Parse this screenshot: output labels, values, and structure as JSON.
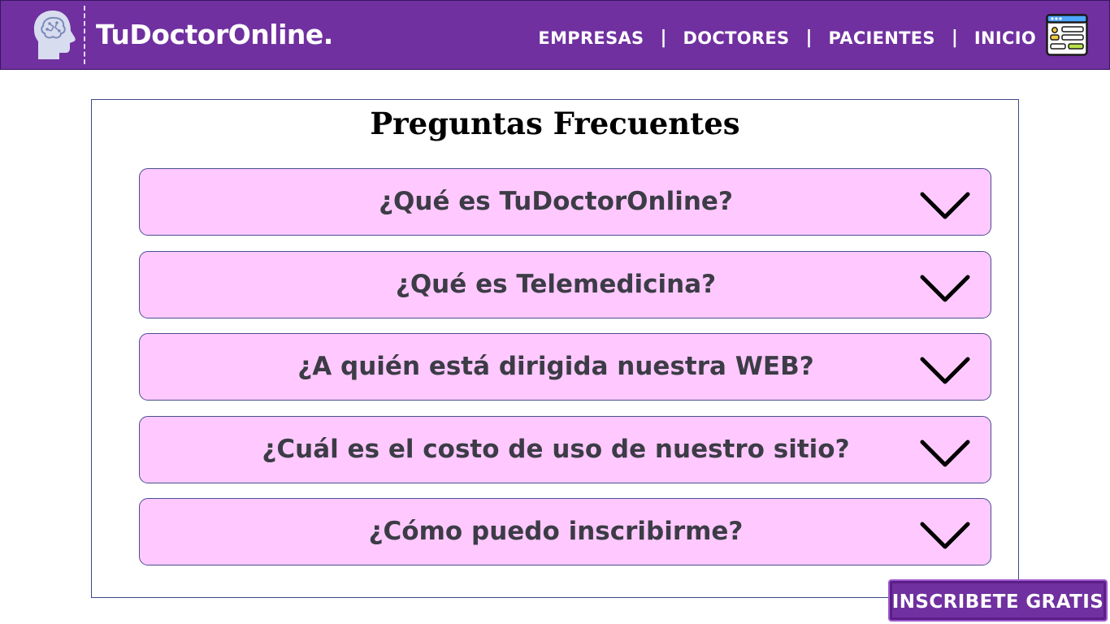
{
  "header": {
    "brand": "TuDoctorOnline.",
    "nav": [
      {
        "label": "EMPRESAS"
      },
      {
        "label": "DOCTORES"
      },
      {
        "label": "PACIENTES"
      },
      {
        "label": "INICIO"
      }
    ],
    "separator": "|",
    "logo_icon": "head-brain-icon",
    "menu_icon": "web-form-icon",
    "colors": {
      "background": "#7030a0",
      "text": "#ffffff"
    }
  },
  "faq": {
    "title": "Preguntas Frecuentes",
    "items": [
      {
        "question": "¿Qué es TuDoctorOnline?",
        "icon": "chevron-down-icon"
      },
      {
        "question": "¿Qué es Telemedicina?",
        "icon": "chevron-down-icon"
      },
      {
        "question": "¿A quién está dirigida nuestra WEB?",
        "icon": "chevron-down-icon"
      },
      {
        "question": "¿Cuál es el costo de uso de nuestro sitio?",
        "icon": "chevron-down-icon"
      },
      {
        "question": "¿Cómo puedo inscribirme?",
        "icon": "chevron-down-icon"
      }
    ],
    "colors": {
      "item_background": "#ffc9ff",
      "item_text": "#3c3c46",
      "border": "#4a4e8e"
    }
  },
  "cta": {
    "label": "INSCRIBETE GRATIS",
    "color": "#7030a0"
  }
}
